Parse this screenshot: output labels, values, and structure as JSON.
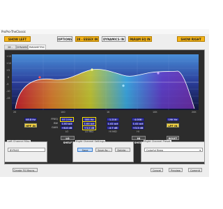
{
  "window": {
    "title": "ProPro-TheClassic"
  },
  "toolbar": {
    "show_left": "SHOW LEFT",
    "options": "OPTIONS",
    "eq_in": "28 - ESSEX IN",
    "dyn_in": "DYNAMICS IN",
    "param_eq_in": "PARAM EQ IN",
    "show_right": "SHOW RIGHT"
  },
  "tabs": [
    "28 - ESSEX",
    "DYNAMICS",
    "PARAMETRIC EQ"
  ],
  "graph": {
    "y_ticks": [
      "+15",
      "+10",
      "+5",
      "0",
      "-5",
      "-10",
      "-15"
    ],
    "x_ticks": [
      "20",
      "100",
      "1K",
      "10K",
      "20K"
    ]
  },
  "controls": {
    "hpf_freq": "48.8 Hz",
    "hpf_btn": "HPF IN",
    "row_labels": [
      "FREQ",
      "BW",
      "GAIN"
    ],
    "lo": {
      "freq": "57.1 Hz",
      "bw": "1.00 oct",
      "gain": "+6.6 dB",
      "label": "LO"
    },
    "lo_mid": {
      "freq": "355 Hz",
      "bw": "1.64 oct",
      "gain": "+3.2 dB",
      "label": "LO MID"
    },
    "hi_mid": {
      "freq": "1.216 Hz",
      "bw": "1.41 oct",
      "gain": "-4.7 dB",
      "label": "HI MID"
    },
    "hi": {
      "freq": "4.006 Hz",
      "bw": "1.41 oct",
      "gain": "+3.3 dB",
      "label": "HI"
    },
    "lpf_freq": "19K Hz",
    "lpf_btn": "LPF IN",
    "lo_shelf": "LO SHELF",
    "hi_shelf": "HI SHELF",
    "reset": "RESET"
  },
  "left_group": {
    "label": "Left Channel Misc",
    "field": "BYPASS"
  },
  "right_settings": {
    "label": "Right Channel Settings",
    "save": "Save",
    "save_as": "Save As...",
    "delete": "Delete..."
  },
  "right_preset": {
    "label": "Right Channel Preset",
    "value": "Colorful Brew"
  },
  "bottom": {
    "create_macro": "Create FX Macro...",
    "cancel": "Cancel",
    "preview": "Preview",
    "commit": "Commit"
  },
  "colors": {
    "accent": "#f5b417",
    "panel": "#2c2c2c",
    "value_box": "#3838a8",
    "toggle_on": "#ffd940"
  }
}
